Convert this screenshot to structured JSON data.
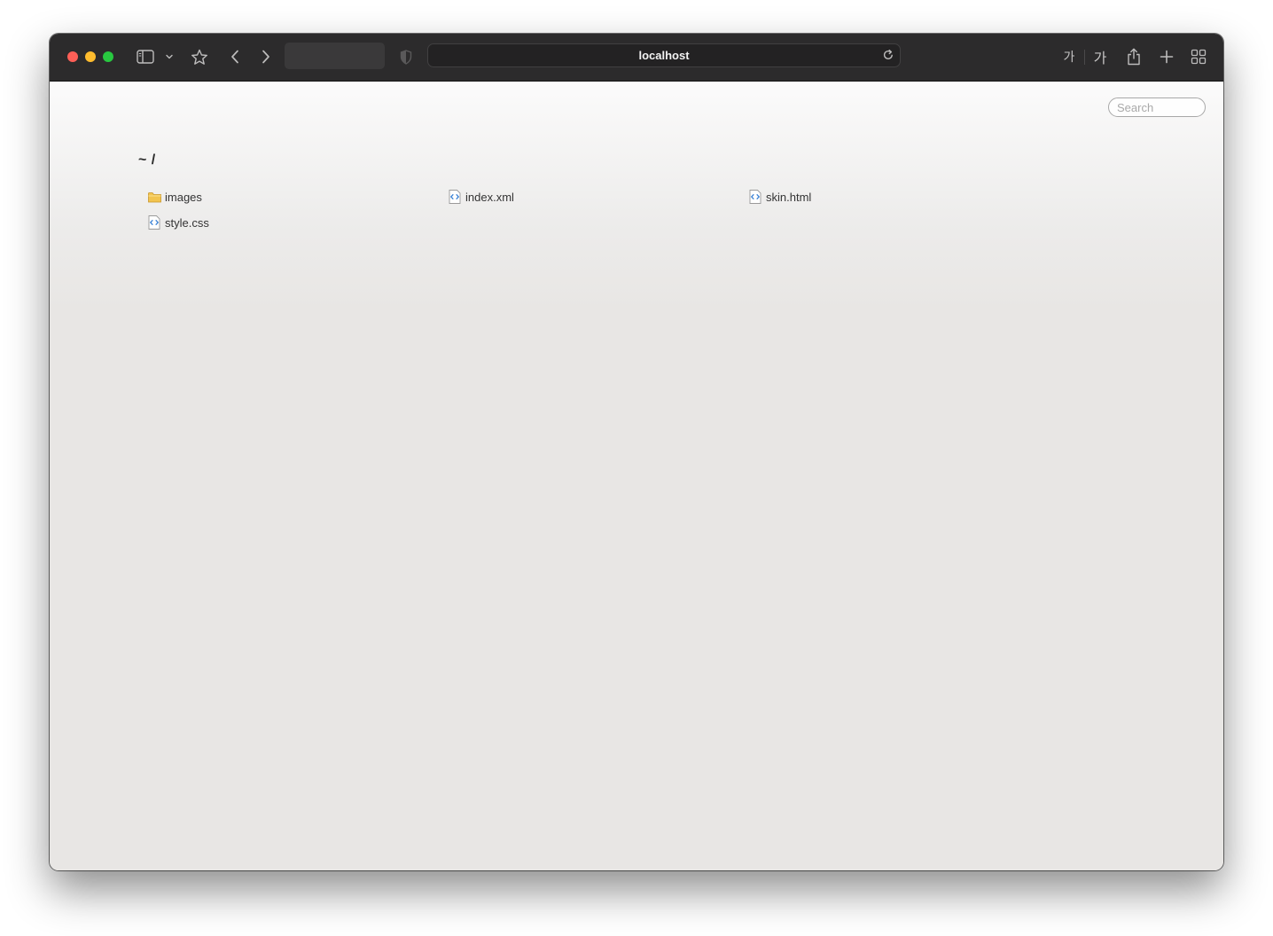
{
  "browser": {
    "url": "localhost",
    "translate_small_label": "가",
    "translate_large_label": "가"
  },
  "page": {
    "search_placeholder": "Search",
    "path_title": "~ /",
    "files": [
      {
        "name": "images",
        "type": "folder",
        "icon": "folder-icon"
      },
      {
        "name": "index.xml",
        "type": "file",
        "icon": "code-file-icon"
      },
      {
        "name": "skin.html",
        "type": "file",
        "icon": "code-file-icon"
      },
      {
        "name": "style.css",
        "type": "file",
        "icon": "code-file-icon"
      }
    ]
  },
  "colors": {
    "toolbar_bg": "#2c2b2c",
    "page_bg": "#e8e6e4",
    "close": "#fe5f57",
    "minimize": "#febc2e",
    "zoom": "#28c840",
    "folder": "#f2c44f",
    "code_icon": "#3b82d6"
  }
}
